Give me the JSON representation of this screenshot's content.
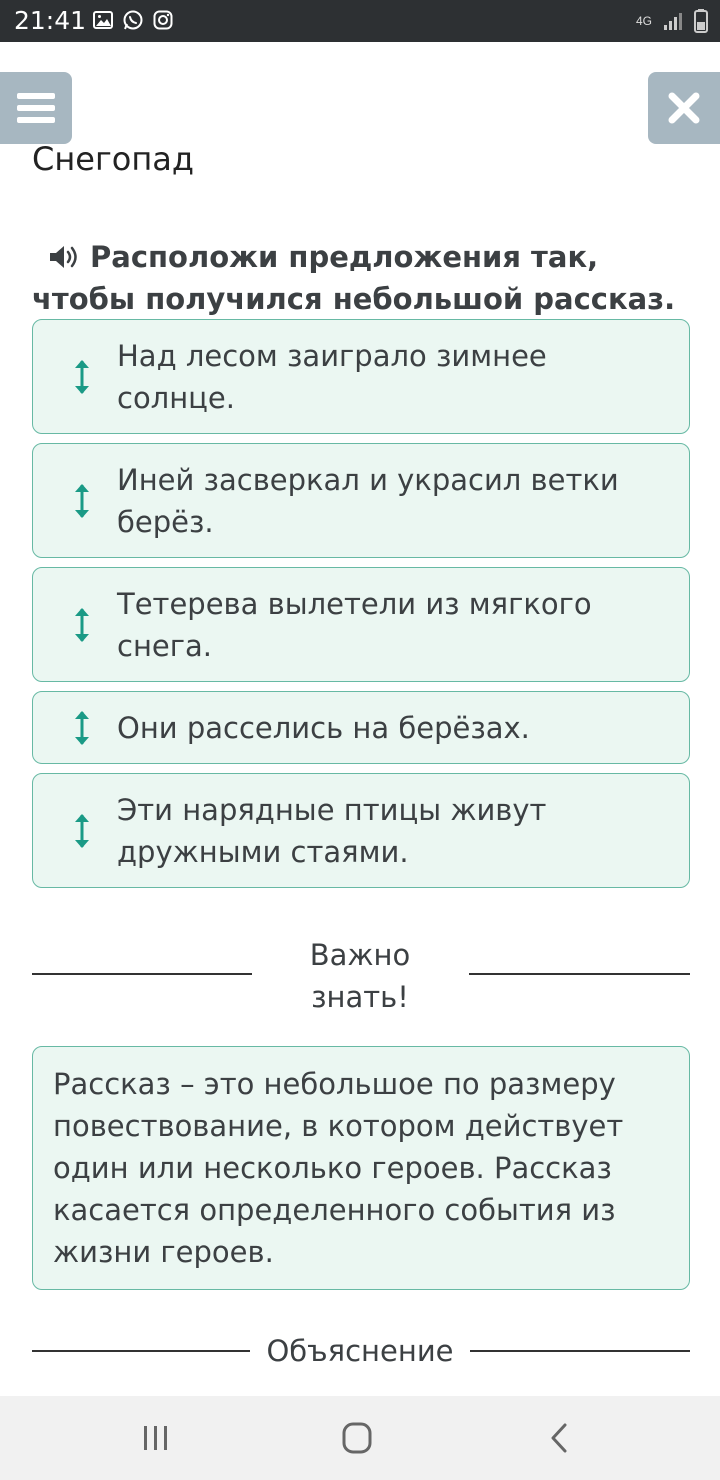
{
  "status_bar": {
    "time": "21:41",
    "network": "4G",
    "left_icons": [
      "gallery-icon",
      "whatsapp-icon",
      "instagram-icon"
    ],
    "right_icons": [
      "network-4g-icon",
      "signal-icon",
      "battery-icon"
    ]
  },
  "header": {
    "title": "Снегопад",
    "menu_icon": "hamburger-menu-icon",
    "close_icon": "close-icon"
  },
  "task": {
    "instruction": "Расположи предложения так, чтобы получился небольшой рассказ.",
    "audio_icon": "speaker-icon",
    "sentences": [
      "Над лесом заиграло зимнее солнце.",
      "Иней засверкал и украсил ветки берёз.",
      "Тетерева вылетели из мягкого снега.",
      "Они расселись на берёзах.",
      "Эти нарядные птицы живут дружными стаями."
    ]
  },
  "important": {
    "label": "Важно знать!",
    "text": "Рассказ – это небольшое по размеру повествование, в котором действует один или несколько героев. Рассказ касается определенного события из жизни героев."
  },
  "explanation": {
    "label": "Объяснение"
  },
  "navigation": {
    "buttons": [
      "recent-apps-icon",
      "home-icon",
      "back-icon"
    ]
  },
  "colors": {
    "status_bar": "#2d3033",
    "header_button": "#a7b7c1",
    "card_background": "#ebf7f2",
    "card_border": "#67b9a4",
    "drag_icon": "#1a9a86",
    "nav_bar": "#f1f1f1"
  }
}
